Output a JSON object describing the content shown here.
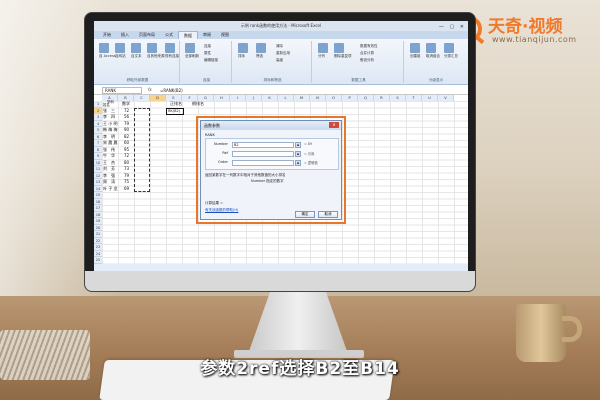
{
  "brand": {
    "name": "天奇·视频",
    "url": "www.tianqijun.com",
    "color": "#f07a2a"
  },
  "subtitle": "参数2ref选择B2至B14",
  "excel": {
    "window_title": "示例 rank函数的使用方法 - Microsoft Excel",
    "window_controls": "— ▢ ✕",
    "tabs": [
      "开始",
      "插入",
      "页面布局",
      "公式",
      "数据",
      "审阅",
      "视图"
    ],
    "active_tab": "数据",
    "ribbon_groups": [
      {
        "label": "获取外部数据",
        "buttons": [
          "自 Access",
          "自网站",
          "自文本",
          "自其他来源",
          "现有连接"
        ]
      },
      {
        "label": "连接",
        "buttons": [
          "全部刷新",
          "连接",
          "属性",
          "编辑链接"
        ]
      },
      {
        "label": "排序和筛选",
        "buttons": [
          "排序",
          "筛选",
          "清除",
          "重新应用",
          "高级"
        ]
      },
      {
        "label": "数据工具",
        "buttons": [
          "分列",
          "删除重复项",
          "数据有效性",
          "合并计算",
          "假设分析"
        ]
      },
      {
        "label": "分级显示",
        "buttons": [
          "创建组",
          "取消组合",
          "分类汇总"
        ]
      }
    ],
    "name_box": "RANK",
    "formula": "=RANK(B2)",
    "columns": [
      "A",
      "B",
      "C",
      "D",
      "E",
      "F",
      "G",
      "H",
      "I",
      "J",
      "K",
      "L",
      "M",
      "N",
      "O",
      "P",
      "Q",
      "R",
      "S",
      "T",
      "U",
      "V"
    ],
    "rows": [
      "1",
      "2",
      "3",
      "4",
      "5",
      "6",
      "7",
      "8",
      "9",
      "10",
      "11",
      "12",
      "13",
      "14",
      "15",
      "16",
      "17",
      "18",
      "19",
      "20",
      "21",
      "22",
      "23",
      "24",
      "25"
    ],
    "headers": {
      "a1_top": "学科",
      "a1_bottom": "姓名",
      "b1": "数学",
      "d1": "正排名",
      "e1": "倒排名"
    },
    "names": [
      "张　三",
      "李　四",
      "王 小 明",
      "韩 梅 梅",
      "李　明",
      "宋 晨 晨",
      "张　伟",
      "牛　华",
      "王　杰",
      "刘　芳",
      "李　强",
      "周　涛",
      "叶 子 龙"
    ],
    "scores": [
      "72",
      "56",
      "79",
      "90",
      "82",
      "60",
      "95",
      "72",
      "80",
      "73",
      "79",
      "75",
      "69"
    ],
    "active_cell_text": "RK(B2)"
  },
  "dialog": {
    "title": "函数参数",
    "close_label": "✕",
    "function_name": "RANK",
    "args": [
      {
        "label": "Number",
        "value": "B2",
        "result": "= 89"
      },
      {
        "label": "Ref",
        "value": "",
        "result": "= 引用"
      },
      {
        "label": "Order",
        "value": "",
        "result": "= 逻辑值"
      }
    ],
    "picker_glyph": "⊞",
    "description": "返回某数字在一列数字中相对于其他数值的大小排名",
    "param_hint": "Number  指定的数字",
    "result_label": "计算结果 =",
    "help_link": "有关该函数的帮助(H)",
    "ok_label": "确定",
    "cancel_label": "取消"
  }
}
